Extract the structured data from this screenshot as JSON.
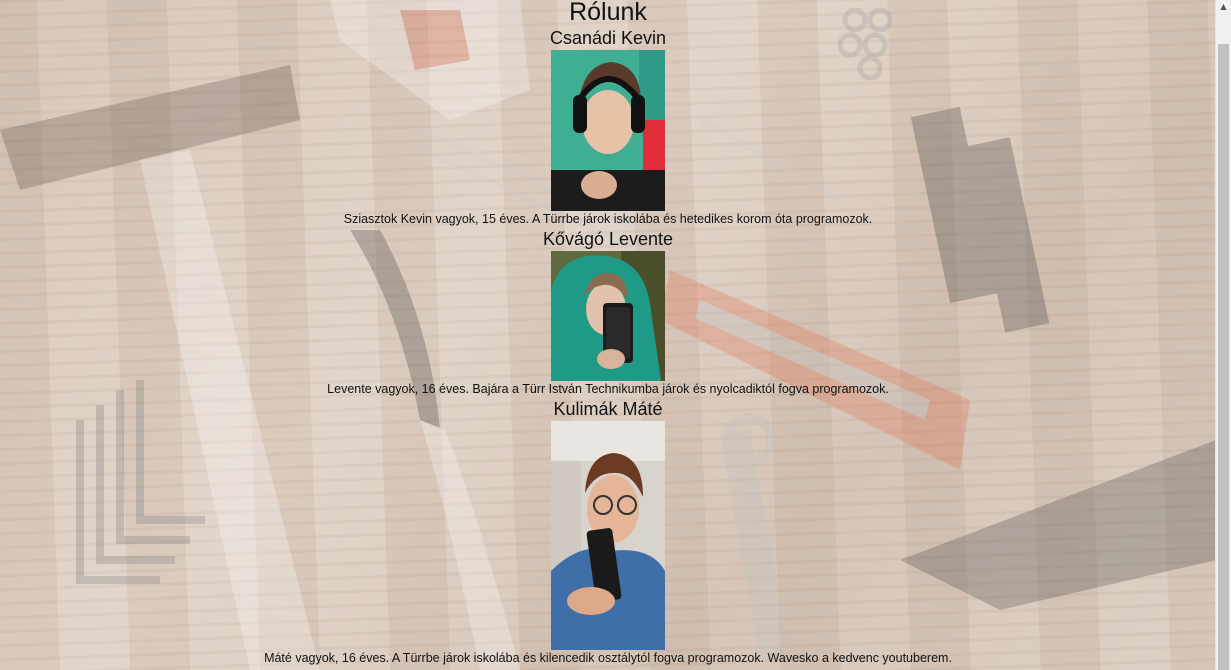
{
  "page": {
    "title": "Rólunk"
  },
  "members": [
    {
      "name": "Csanádi Kevin",
      "bio": "Sziasztok Kevin vagyok, 15 éves. A Türrbe járok iskolába és hetedikes korom óta programozok."
    },
    {
      "name": "Kővágó Levente",
      "bio": "Levente vagyok, 16 éves. Bajára a Türr István Technikumba járok és nyolcadiktól fogva programozok."
    },
    {
      "name": "Kulimák Máté",
      "bio": "Máté vagyok, 16 éves. A Türrbe járok iskolába és kilencedik osztálytól fogva programozok. Wavesko a kedvenc youtuberem."
    }
  ],
  "scrollbar": {
    "up_arrow_icon": "triangle-up"
  }
}
